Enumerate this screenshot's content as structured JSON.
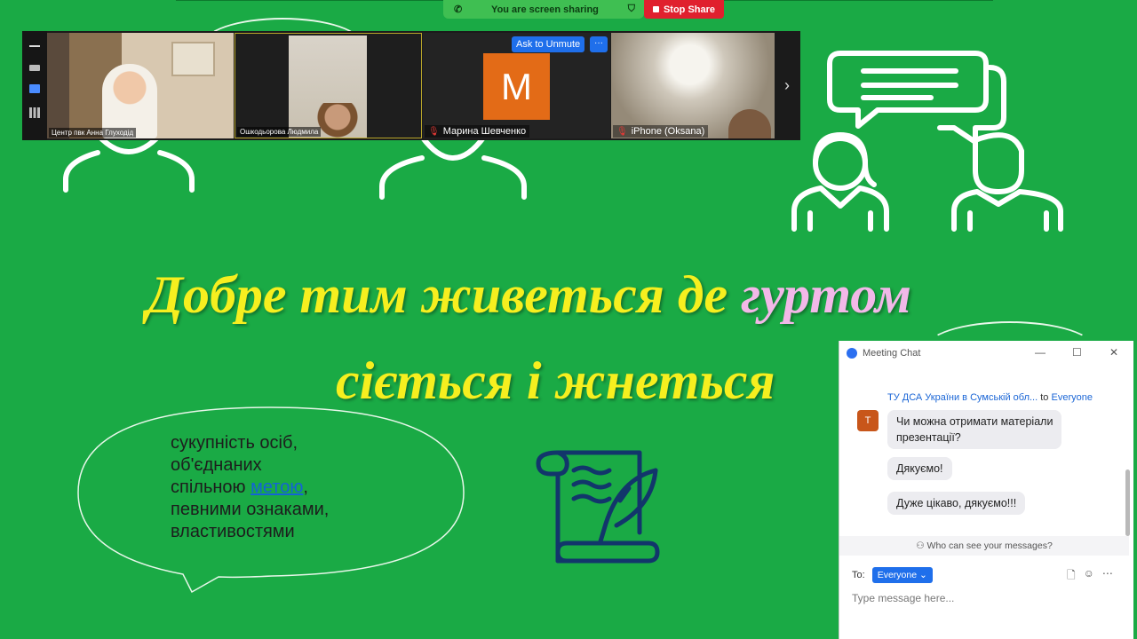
{
  "share_bar": {
    "status_text": "You are screen sharing",
    "stop_label": "Stop Share"
  },
  "video_strip": {
    "tiles": [
      {
        "name": "Центр пвк Анна Глуходід"
      },
      {
        "name": "Ошкодьорова Людмила"
      },
      {
        "name": "Марина Шевченко",
        "avatar_letter": "M",
        "muted": true
      },
      {
        "name": "iPhone (Oksana)",
        "muted": true
      }
    ],
    "ask_unmute_label": "Ask to Unmute",
    "more_label": "···"
  },
  "slide": {
    "title_line1_a": "Добре тим живеться де ",
    "title_line1_b": "гуртом",
    "title_line2": "сіється і жнеться",
    "bubble_line1": "сукупність осіб,",
    "bubble_line2": "об'єднаних",
    "bubble_line3a": "спільною ",
    "bubble_link": "метою",
    "bubble_line3b": ",",
    "bubble_line4": "певними ознаками,",
    "bubble_line5": "властивостями",
    "colors": {
      "background": "#1aaa45",
      "title": "#f6ef1f",
      "accent_word": "#f2b8e8",
      "icon_navy": "#12366b"
    }
  },
  "chat": {
    "title": "Meeting Chat",
    "sender": "ТУ ДСА України в  Сумській обл...",
    "to_word": "to",
    "recipient": "Everyone",
    "avatar_letter": "T",
    "messages": [
      {
        "line1": "Чи можна отримати матеріали",
        "line2": "презентації?"
      },
      {
        "line1": "Дякуємо!"
      },
      {
        "line1": "Дуже цікаво, дякуємо!!!"
      }
    ],
    "privacy_text": "Who can see your messages?",
    "to_label": "To:",
    "to_value": "Everyone",
    "input_placeholder": "Type message here..."
  }
}
